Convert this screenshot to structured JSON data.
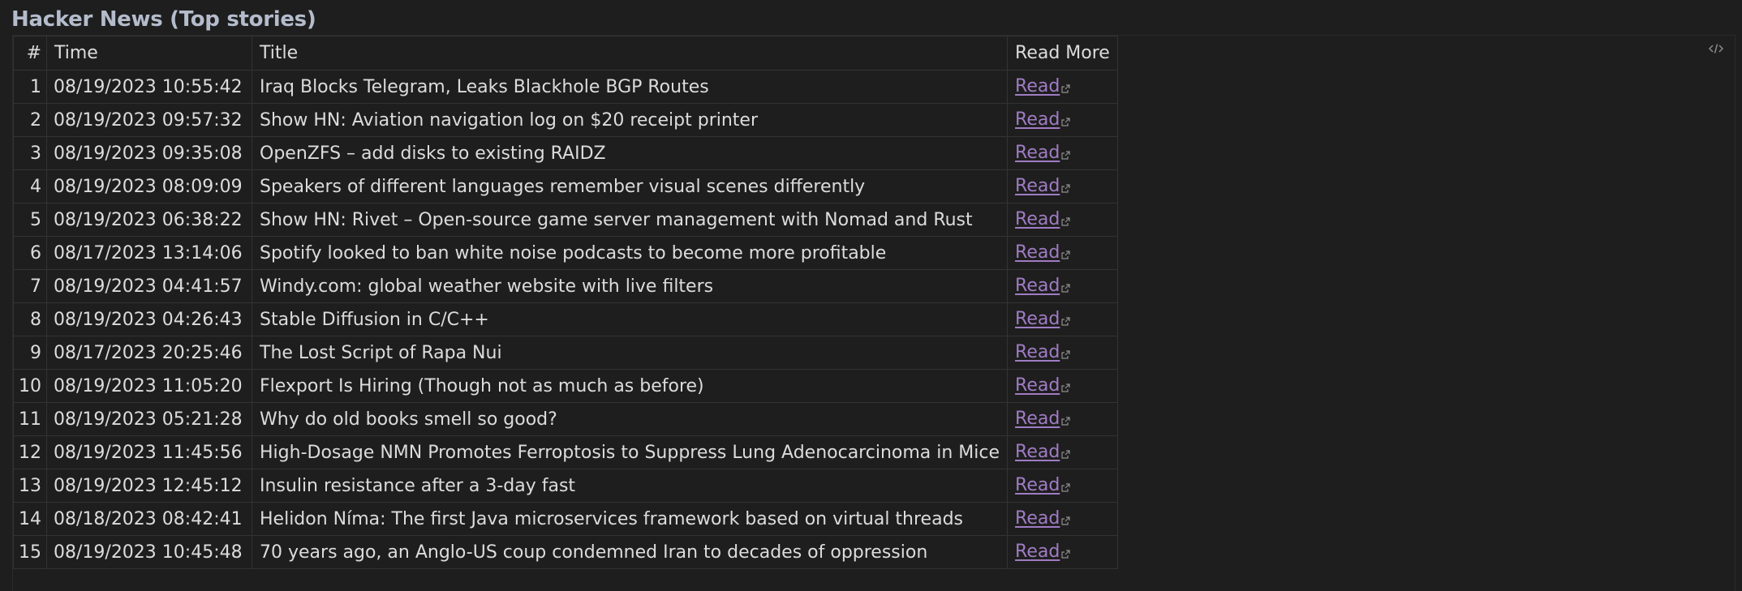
{
  "page": {
    "title": "Hacker News (Top stories)"
  },
  "colors": {
    "background": "#1e1e1e",
    "title": "#b4bccc",
    "text": "#dcdcdc",
    "link": "#a07cc4",
    "border": "#333333"
  },
  "table": {
    "headers": {
      "num": "#",
      "time": "Time",
      "title": "Title",
      "read_more": "Read More"
    },
    "rows": [
      {
        "num": "1",
        "time": "08/19/2023 10:55:42",
        "title": "Iraq Blocks Telegram, Leaks Blackhole BGP Routes",
        "link": "Read"
      },
      {
        "num": "2",
        "time": "08/19/2023 09:57:32",
        "title": "Show HN: Aviation navigation log on $20 receipt printer",
        "link": "Read"
      },
      {
        "num": "3",
        "time": "08/19/2023 09:35:08",
        "title": "OpenZFS – add disks to existing RAIDZ",
        "link": "Read"
      },
      {
        "num": "4",
        "time": "08/19/2023 08:09:09",
        "title": "Speakers of different languages remember visual scenes differently",
        "link": "Read"
      },
      {
        "num": "5",
        "time": "08/19/2023 06:38:22",
        "title": "Show HN: Rivet – Open-source game server management with Nomad and Rust",
        "link": "Read"
      },
      {
        "num": "6",
        "time": "08/17/2023 13:14:06",
        "title": "Spotify looked to ban white noise podcasts to become more profitable",
        "link": "Read"
      },
      {
        "num": "7",
        "time": "08/19/2023 04:41:57",
        "title": "Windy.com: global weather website with live filters",
        "link": "Read"
      },
      {
        "num": "8",
        "time": "08/19/2023 04:26:43",
        "title": "Stable Diffusion in C/C++",
        "link": "Read"
      },
      {
        "num": "9",
        "time": "08/17/2023 20:25:46",
        "title": "The Lost Script of Rapa Nui",
        "link": "Read"
      },
      {
        "num": "10",
        "time": "08/19/2023 11:05:20",
        "title": "Flexport Is Hiring (Though not as much as before)",
        "link": "Read"
      },
      {
        "num": "11",
        "time": "08/19/2023 05:21:28",
        "title": "Why do old books smell so good?",
        "link": "Read"
      },
      {
        "num": "12",
        "time": "08/19/2023 11:45:56",
        "title": "High-Dosage NMN Promotes Ferroptosis to Suppress Lung Adenocarcinoma in Mice",
        "link": "Read"
      },
      {
        "num": "13",
        "time": "08/19/2023 12:45:12",
        "title": "Insulin resistance after a 3-day fast",
        "link": "Read"
      },
      {
        "num": "14",
        "time": "08/18/2023 08:42:41",
        "title": "Helidon Níma: The first Java microservices framework based on virtual threads",
        "link": "Read"
      },
      {
        "num": "15",
        "time": "08/19/2023 10:45:48",
        "title": "70 years ago, an Anglo-US coup condemned Iran to decades of oppression",
        "link": "Read"
      }
    ]
  },
  "icons": {
    "code_toggle": "code-brackets-icon",
    "external_link": "external-link-icon"
  }
}
